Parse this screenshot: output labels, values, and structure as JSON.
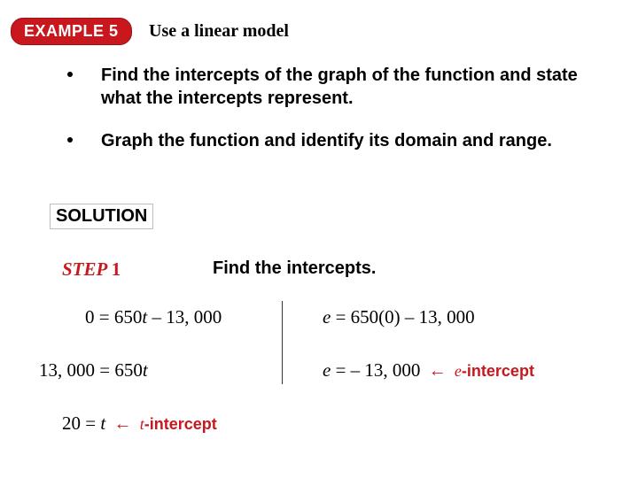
{
  "badge": "EXAMPLE 5",
  "title": "Use a linear model",
  "bullets": [
    "Find the intercepts of the graph of the function and state what the intercepts represent.",
    "Graph the function and identify its domain and range."
  ],
  "solution_label": "SOLUTION",
  "step": {
    "label": "STEP",
    "num": "1",
    "text": "Find the intercepts."
  },
  "eq": {
    "left1_a": "0 = 650",
    "left1_b": "t",
    "left1_c": " – 13, 000",
    "left2_a": "13, 000 = 650",
    "left2_b": "t",
    "left3_a": "20 = ",
    "left3_b": "t",
    "left3_arrow": "←",
    "left3_label_a": "t",
    "left3_label_b": "-intercept",
    "right1_a": "e",
    "right1_b": " = 650(0) – 13, 000",
    "right2_a": "e",
    "right2_b": " = – 13, 000",
    "right2_arrow": "←",
    "right2_label_a": "e",
    "right2_label_b": "-intercept"
  }
}
